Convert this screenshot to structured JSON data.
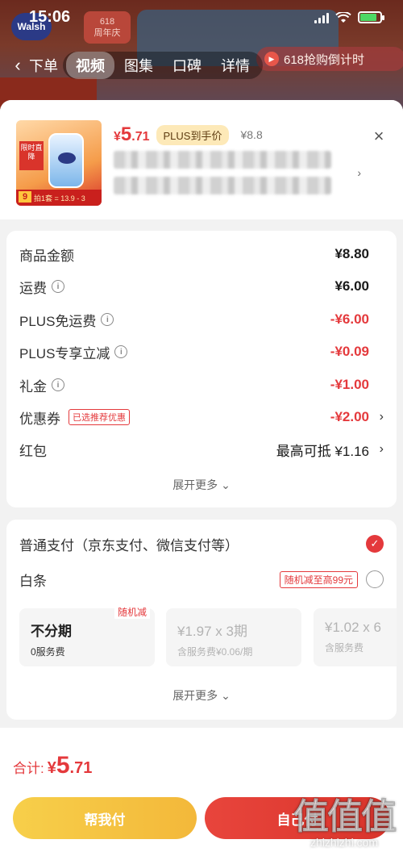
{
  "status_bar": {
    "time": "15:06"
  },
  "background": {
    "brand": "Walsh",
    "anniversary": "618\n周年庆",
    "back_label": "下单",
    "promo_text": "618抢购倒计时",
    "tabs": [
      {
        "label": "视频",
        "active": true
      },
      {
        "label": "图集",
        "active": false
      },
      {
        "label": "口碑",
        "active": false
      },
      {
        "label": "详情",
        "active": false
      }
    ]
  },
  "product": {
    "price_currency": "¥",
    "price_int": "5",
    "price_dec": ".71",
    "plus_tag": "PLUS到手价",
    "original_price": "¥8.8",
    "close_icon": "close-icon",
    "thumb": {
      "tag": "限时直降",
      "nine": "9",
      "bottom_text": "拍1套 = 13.9 - 3"
    }
  },
  "fees": {
    "rows": [
      {
        "label": "商品金额",
        "info": false,
        "value": "¥8.80",
        "red": false,
        "arrow": false
      },
      {
        "label": "运费",
        "info": true,
        "value": "¥6.00",
        "red": false,
        "arrow": false
      },
      {
        "label": "PLUS免运费",
        "info": true,
        "value": "-¥6.00",
        "red": true,
        "arrow": false
      },
      {
        "label": "PLUS专享立减",
        "info": true,
        "value": "-¥0.09",
        "red": true,
        "arrow": false
      },
      {
        "label": "礼金",
        "info": true,
        "value": "-¥1.00",
        "red": true,
        "arrow": false
      },
      {
        "label": "优惠券",
        "info": false,
        "tag": "已选推荐优惠",
        "value": "-¥2.00",
        "red": true,
        "arrow": true
      },
      {
        "label": "红包",
        "info": false,
        "value": "最高可抵 ¥1.16",
        "red": false,
        "arrow": true
      }
    ],
    "expand_more": "展开更多"
  },
  "payment": {
    "normal_label": "普通支付（京东支付、微信支付等）",
    "normal_selected": true,
    "baitiao_label": "白条",
    "baitiao_promo": "随机减至高99元",
    "plans": [
      {
        "title": "不分期",
        "sub": "0服务费",
        "badge": "随机减",
        "disabled": false
      },
      {
        "title": "¥1.97 x 3期",
        "sub": "含服务费¥0.06/期",
        "disabled": true
      },
      {
        "title": "¥1.02 x 6",
        "sub": "含服务费",
        "disabled": true
      }
    ],
    "expand_more": "展开更多"
  },
  "footer": {
    "total_label": "合计:",
    "total_currency": "¥",
    "total_int": "5",
    "total_dec": ".71",
    "help_pay": "帮我付",
    "self_pay": "自己付",
    "watermark_logo": "值值值",
    "watermark_url": "zhizhizhi.com"
  },
  "colors": {
    "accent_red": "#e4393c",
    "plus_bg": "#fde9b8",
    "help_yellow": "#f5c542"
  }
}
